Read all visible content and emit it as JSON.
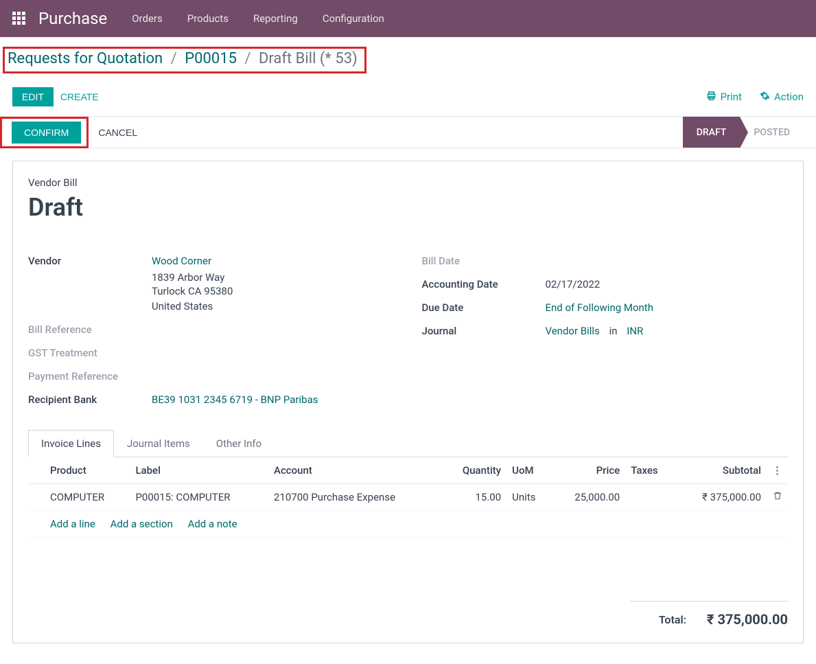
{
  "nav": {
    "brand": "Purchase",
    "menus": [
      "Orders",
      "Products",
      "Reporting",
      "Configuration"
    ]
  },
  "breadcrumb": {
    "root": "Requests for Quotation",
    "mid": "P00015",
    "current": "Draft Bill (* 53)"
  },
  "actions": {
    "edit": "EDIT",
    "create": "CREATE",
    "print": "Print",
    "action": "Action"
  },
  "statusbar": {
    "confirm": "CONFIRM",
    "cancel": "CANCEL",
    "stages": {
      "draft": "DRAFT",
      "posted": "POSTED"
    }
  },
  "form": {
    "doctype_label": "Vendor Bill",
    "status": "Draft",
    "left": {
      "vendor_label": "Vendor",
      "vendor_name": "Wood Corner",
      "vendor_addr1": "1839 Arbor Way",
      "vendor_addr2": "Turlock CA 95380",
      "vendor_addr3": "United States",
      "bill_ref_label": "Bill Reference",
      "gst_label": "GST Treatment",
      "payref_label": "Payment Reference",
      "bank_label": "Recipient Bank",
      "bank_value": "BE39 1031 2345 6719 - BNP Paribas"
    },
    "right": {
      "billdate_label": "Bill Date",
      "acctdate_label": "Accounting Date",
      "acctdate_value": "02/17/2022",
      "duedate_label": "Due Date",
      "duedate_value": "End of Following Month",
      "journal_label": "Journal",
      "journal_value": "Vendor Bills",
      "journal_in": "in",
      "journal_currency": "INR"
    }
  },
  "tabs": {
    "invoice_lines": "Invoice Lines",
    "journal_items": "Journal Items",
    "other_info": "Other Info"
  },
  "table": {
    "headers": {
      "product": "Product",
      "label": "Label",
      "account": "Account",
      "quantity": "Quantity",
      "uom": "UoM",
      "price": "Price",
      "taxes": "Taxes",
      "subtotal": "Subtotal"
    },
    "row": {
      "product": "COMPUTER",
      "label": "P00015: COMPUTER",
      "account": "210700 Purchase Expense",
      "quantity": "15.00",
      "uom": "Units",
      "price": "25,000.00",
      "taxes": "",
      "subtotal": "₹ 375,000.00"
    },
    "addline": "Add a line",
    "addsection": "Add a section",
    "addnote": "Add a note"
  },
  "totals": {
    "label": "Total:",
    "value": "₹ 375,000.00"
  }
}
